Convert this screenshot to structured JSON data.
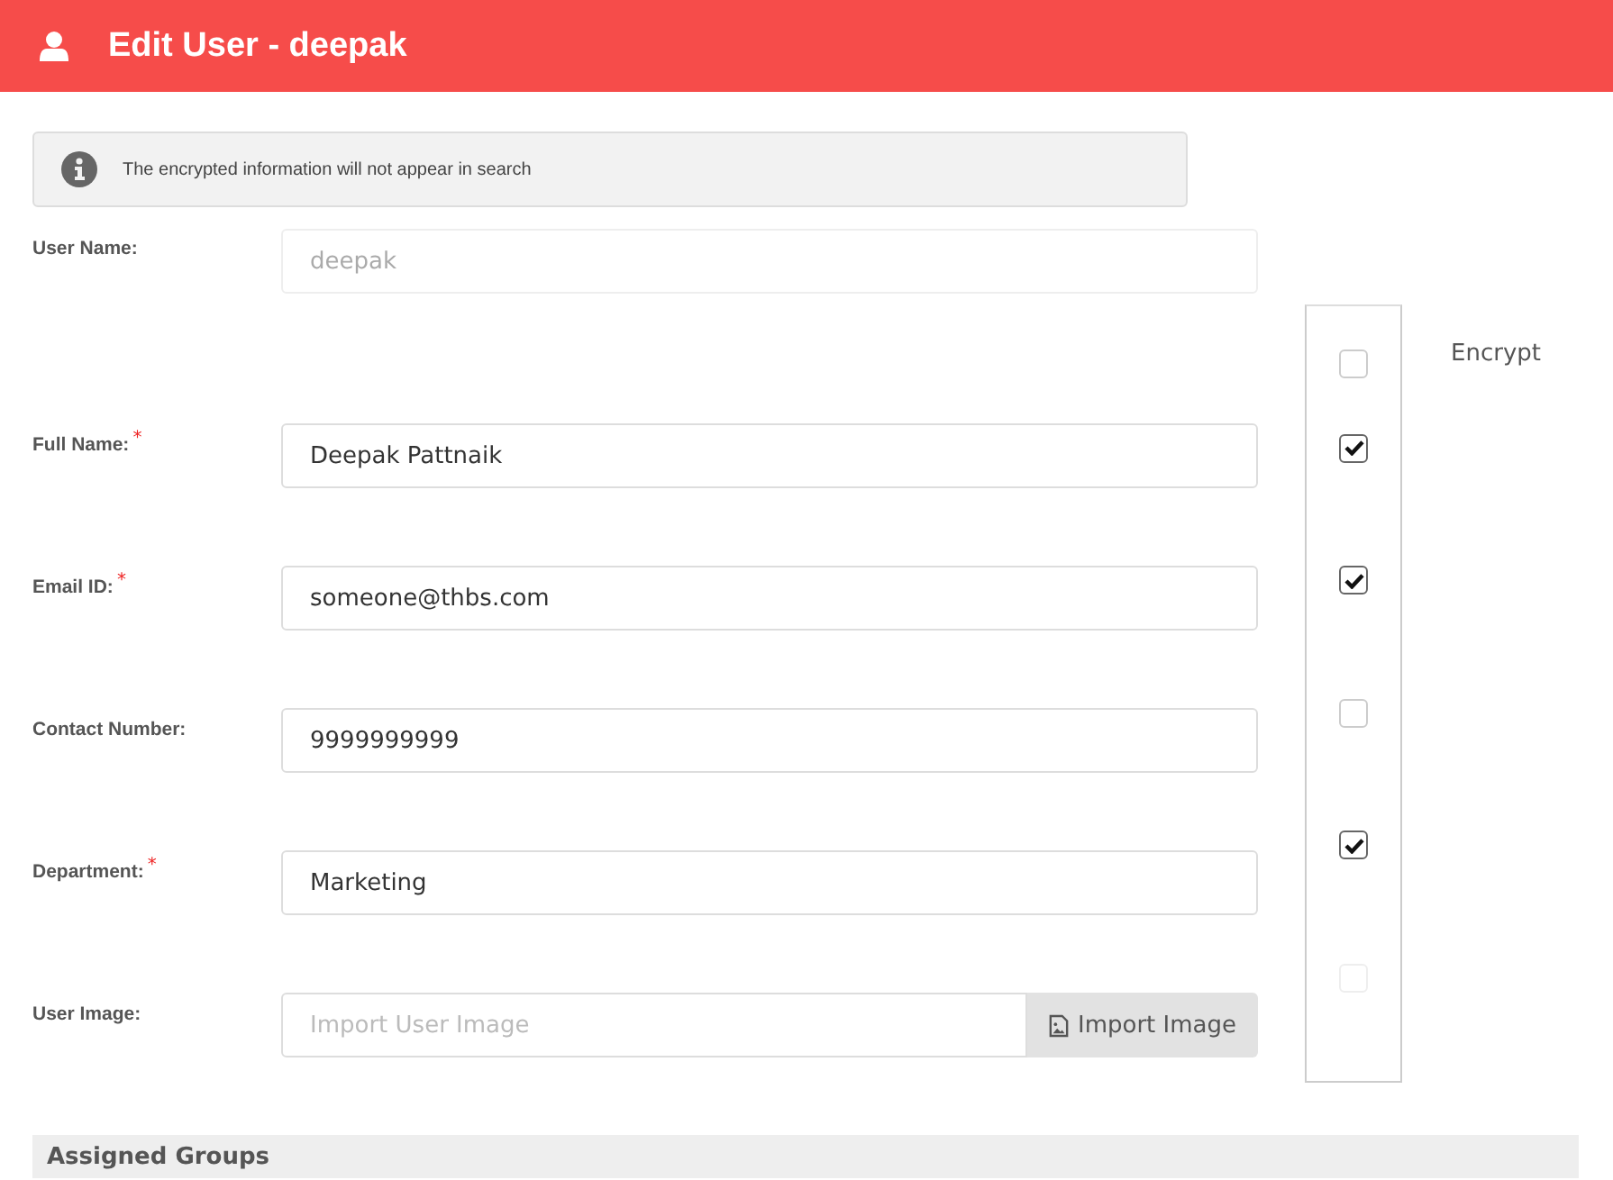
{
  "header": {
    "title": "Edit User - deepak"
  },
  "notice": {
    "text": "The encrypted information will not appear in search"
  },
  "user_name": {
    "label": "User Name:",
    "value": "deepak",
    "disabled": true
  },
  "encrypt": {
    "label": "Encrypt",
    "select_all": {
      "checked": false
    }
  },
  "fields": [
    {
      "kind": "text",
      "label": "Full Name:",
      "required_mark": "*",
      "value": "Deepak Pattnaik",
      "encrypt": {
        "checked": true,
        "disabled": false
      }
    },
    {
      "kind": "text",
      "label": "Email ID:",
      "required_mark": "*",
      "value": "someone@thbs.com",
      "encrypt": {
        "checked": true,
        "disabled": false
      }
    },
    {
      "kind": "text",
      "label": "Contact Number:",
      "value": "9999999999",
      "encrypt": {
        "checked": false,
        "disabled": false
      }
    },
    {
      "kind": "text",
      "label": "Department:",
      "required_mark": "*",
      "value": "Marketing",
      "encrypt": {
        "checked": true,
        "disabled": false
      }
    },
    {
      "kind": "file",
      "label": "User Image:",
      "placeholder": "Import User Image",
      "button": "Import Image",
      "encrypt": {
        "checked": false,
        "disabled": true
      }
    }
  ],
  "section": {
    "title": "Assigned Groups"
  }
}
